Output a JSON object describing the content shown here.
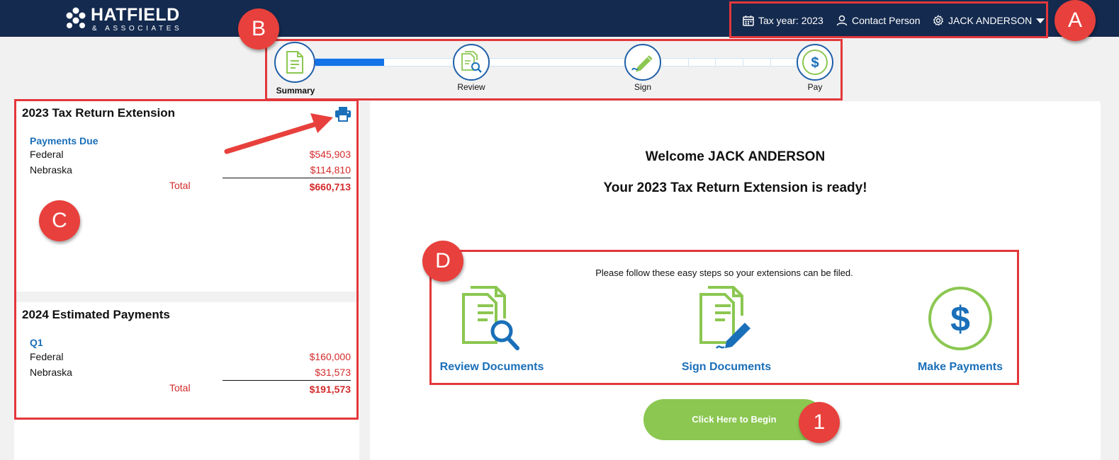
{
  "header": {
    "logo_name": "HATFIELD",
    "logo_sub": "& ASSOCIATES",
    "tax_year": "Tax year: 2023",
    "contact": "Contact Person",
    "user": "JACK ANDERSON"
  },
  "callouts": {
    "a": "A",
    "b": "B",
    "c": "C",
    "d": "D",
    "one": "1"
  },
  "progress": {
    "steps": [
      {
        "label": "Summary",
        "icon": "document-icon",
        "active": true
      },
      {
        "label": "Review",
        "icon": "document-search-icon"
      },
      {
        "label": "Sign",
        "icon": "pen-icon"
      },
      {
        "label": "Pay",
        "icon": "dollar-icon"
      }
    ],
    "completed_fraction": 0.13
  },
  "extension": {
    "title": "2023 Tax Return Extension",
    "subtitle": "Payments Due",
    "rows": [
      {
        "label": "Federal",
        "value": "$545,903"
      },
      {
        "label": "Nebraska",
        "value": "$114,810"
      }
    ],
    "total_label": "Total",
    "total_value": "$660,713"
  },
  "estimated": {
    "title": "2024 Estimated Payments",
    "subtitle": "Q1",
    "rows": [
      {
        "label": "Federal",
        "value": "$160,000"
      },
      {
        "label": "Nebraska",
        "value": "$31,573"
      }
    ],
    "total_label": "Total",
    "total_value": "$191,573"
  },
  "main": {
    "welcome": "Welcome JACK ANDERSON",
    "ready": "Your 2023 Tax Return Extension is ready!",
    "instructions": "Please follow these easy steps so your extensions can be filed.",
    "tiles": [
      {
        "label": "Review Documents",
        "icon": "review-documents-icon"
      },
      {
        "label": "Sign Documents",
        "icon": "sign-documents-icon"
      },
      {
        "label": "Make Payments",
        "icon": "make-payments-icon"
      }
    ],
    "begin_button": "Click Here to Begin"
  },
  "colors": {
    "header_bg": "#142a4f",
    "accent_blue": "#1a6fb9",
    "accent_green": "#8bc751",
    "money_red": "#d42a2a",
    "callout_red": "#e8403c"
  }
}
